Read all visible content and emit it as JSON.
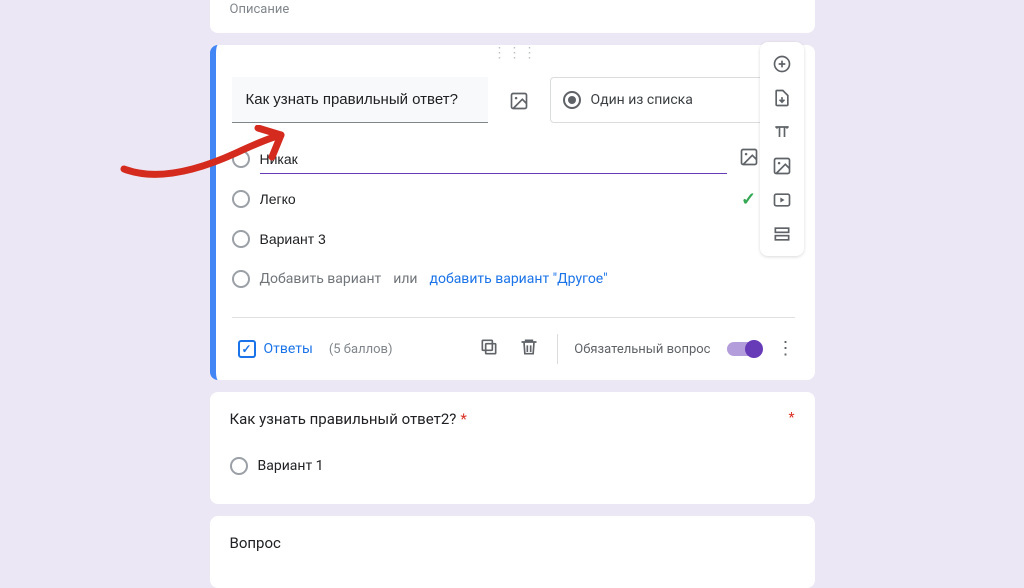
{
  "description_card": {
    "label": "Описание"
  },
  "question": {
    "text": "Как узнать правильный ответ?",
    "type_label": "Один из списка",
    "options": [
      {
        "text": "Никак",
        "correct": false,
        "has_img_btn": true,
        "active": true
      },
      {
        "text": "Легко",
        "correct": true,
        "has_img_btn": false,
        "active": false
      },
      {
        "text": "Вариант 3",
        "correct": false,
        "has_img_btn": false,
        "active": false
      }
    ],
    "add_option": {
      "placeholder": "Добавить вариант",
      "or": "или",
      "other": "добавить вариант \"Другое\""
    },
    "answers_label": "Ответы",
    "points_label": "(5 баллов)",
    "required_label": "Обязательный вопрос",
    "required_on": true
  },
  "question2": {
    "title": "Как узнать правильный ответ2?",
    "required": true,
    "option": "Вариант 1"
  },
  "question3": {
    "title": "Вопрос"
  },
  "toolbar": {
    "add": "add-question",
    "import": "import-questions",
    "title": "add-title",
    "image": "add-image",
    "video": "add-video",
    "section": "add-section"
  },
  "colors": {
    "accent": "#673ab7",
    "link": "#1a73e8",
    "correct": "#34a853"
  }
}
